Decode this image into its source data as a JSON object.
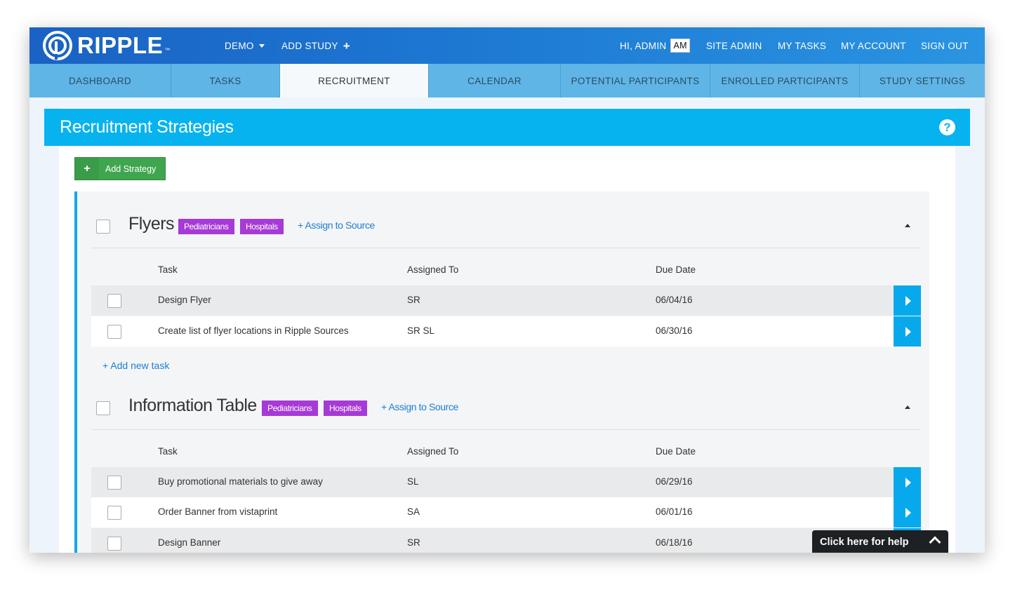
{
  "app": {
    "logo_text": "RIPPLE",
    "logo_tm": "™"
  },
  "topnav": {
    "demo_label": "DEMO",
    "add_study_label": "ADD STUDY",
    "greeting": "HI, ADMIN",
    "user_initials": "AM",
    "site_admin": "SITE ADMIN",
    "my_tasks": "MY TASKS",
    "my_account": "MY ACCOUNT",
    "sign_out": "SIGN OUT"
  },
  "tabs": [
    {
      "label": "DASHBOARD",
      "active": false
    },
    {
      "label": "TASKS",
      "active": false
    },
    {
      "label": "RECRUITMENT",
      "active": true
    },
    {
      "label": "CALENDAR",
      "active": false
    },
    {
      "label": "POTENTIAL PARTICIPANTS",
      "active": false
    },
    {
      "label": "ENROLLED PARTICIPANTS",
      "active": false
    },
    {
      "label": "STUDY SETTINGS",
      "active": false
    }
  ],
  "section": {
    "title": "Recruitment Strategies",
    "help_glyph": "?"
  },
  "add_strategy": {
    "plus": "+",
    "label": "Add Strategy"
  },
  "columns": {
    "task": "Task",
    "assigned_to": "Assigned To",
    "due_date": "Due Date"
  },
  "strategies": [
    {
      "name": "Flyers",
      "tags": [
        "Pediatricians",
        "Hospitals"
      ],
      "assign_link": "+ Assign to Source",
      "add_task": "+ Add new task",
      "tasks": [
        {
          "task": "Design Flyer",
          "assigned_to": "SR",
          "due_date": "06/04/16"
        },
        {
          "task": "Create list of flyer locations in Ripple Sources",
          "assigned_to": "SR SL",
          "due_date": "06/30/16"
        }
      ]
    },
    {
      "name": "Information Table",
      "tags": [
        "Pediatricians",
        "Hospitals"
      ],
      "assign_link": "+ Assign to Source",
      "tasks": [
        {
          "task": "Buy promotional materials to give away",
          "assigned_to": "SL",
          "due_date": "06/29/16"
        },
        {
          "task": "Order Banner from vistaprint",
          "assigned_to": "SA",
          "due_date": "06/01/16"
        },
        {
          "task": "Design Banner",
          "assigned_to": "SR",
          "due_date": "06/18/16"
        }
      ]
    }
  ],
  "help_bar": {
    "label": "Click here for help"
  },
  "colors": {
    "topbar": "#1d78d2",
    "tab_strip": "#5fb6e6",
    "header_band": "#07b3ef",
    "tag": "#a63ad6",
    "add_button": "#3fa64f",
    "link": "#1c7fd0",
    "row_arrow": "#07a9ec"
  }
}
